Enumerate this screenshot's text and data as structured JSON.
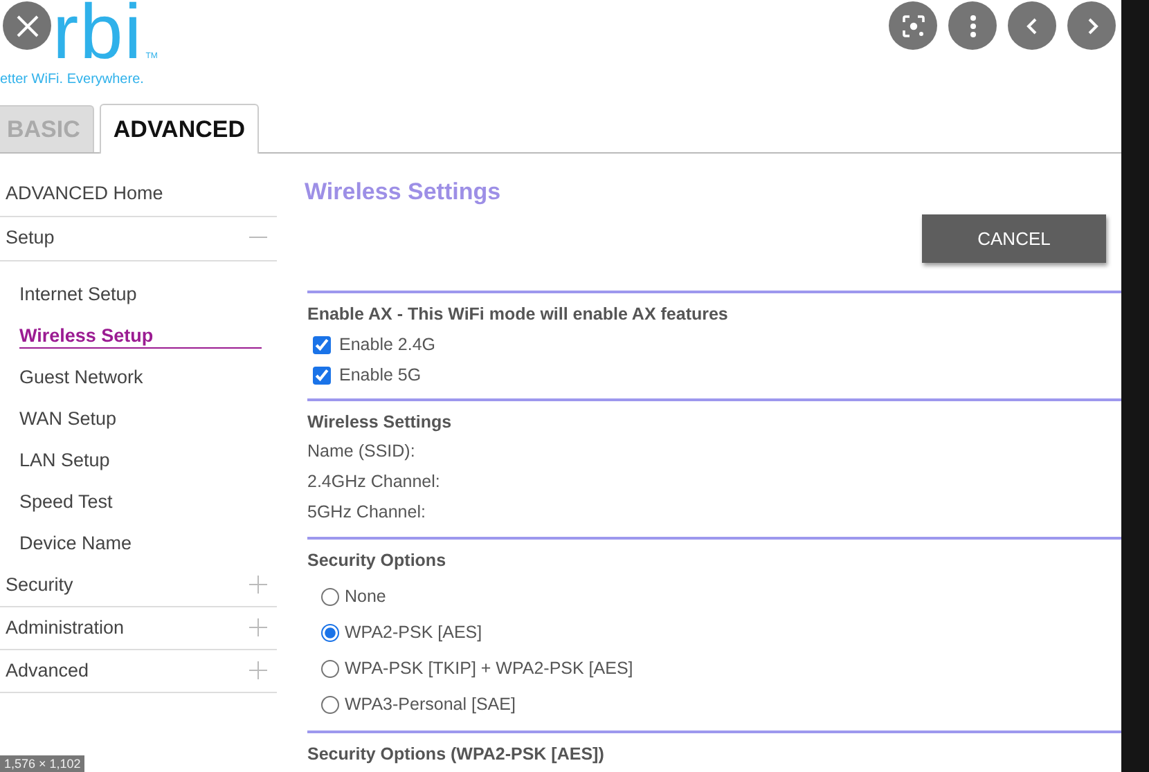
{
  "logo": {
    "wordmark": "rbi",
    "trademark": "TM",
    "tagline": "etter WiFi. Everywhere."
  },
  "tabs": [
    {
      "label": "BASIC",
      "selected": false
    },
    {
      "label": "ADVANCED",
      "selected": true
    }
  ],
  "sidebar": {
    "items": [
      {
        "label": "ADVANCED Home",
        "kind": "link"
      },
      {
        "label": "Setup",
        "kind": "group",
        "expanded": true,
        "children": [
          {
            "label": "Internet Setup",
            "selected": false
          },
          {
            "label": "Wireless Setup",
            "selected": true
          },
          {
            "label": "Guest Network",
            "selected": false
          },
          {
            "label": "WAN Setup",
            "selected": false
          },
          {
            "label": "LAN Setup",
            "selected": false
          },
          {
            "label": "Speed Test",
            "selected": false
          },
          {
            "label": "Device Name",
            "selected": false
          }
        ]
      },
      {
        "label": "Security",
        "kind": "group",
        "expanded": false
      },
      {
        "label": "Administration",
        "kind": "group",
        "expanded": false
      },
      {
        "label": "Advanced",
        "kind": "group",
        "expanded": false
      }
    ]
  },
  "page": {
    "title": "Wireless Settings",
    "cancel_button": "CANCEL",
    "ax_section": {
      "heading": "Enable AX - This WiFi mode will enable AX features",
      "options": [
        {
          "label": "Enable 2.4G",
          "checked": true
        },
        {
          "label": "Enable 5G",
          "checked": true
        }
      ]
    },
    "wireless_section": {
      "heading": "Wireless Settings",
      "fields": [
        "Name (SSID):",
        "2.4GHz Channel:",
        "5GHz Channel:"
      ]
    },
    "security_section": {
      "heading": "Security Options",
      "options": [
        {
          "label": "None",
          "selected": false
        },
        {
          "label": "WPA2-PSK [AES]",
          "selected": true
        },
        {
          "label": "WPA-PSK [TKIP] + WPA2-PSK [AES]",
          "selected": false
        },
        {
          "label": "WPA3-Personal [SAE]",
          "selected": false
        }
      ]
    },
    "next_heading": "Security Options (WPA2-PSK [AES])"
  },
  "image_size_badge": "1,576 × 1,102"
}
